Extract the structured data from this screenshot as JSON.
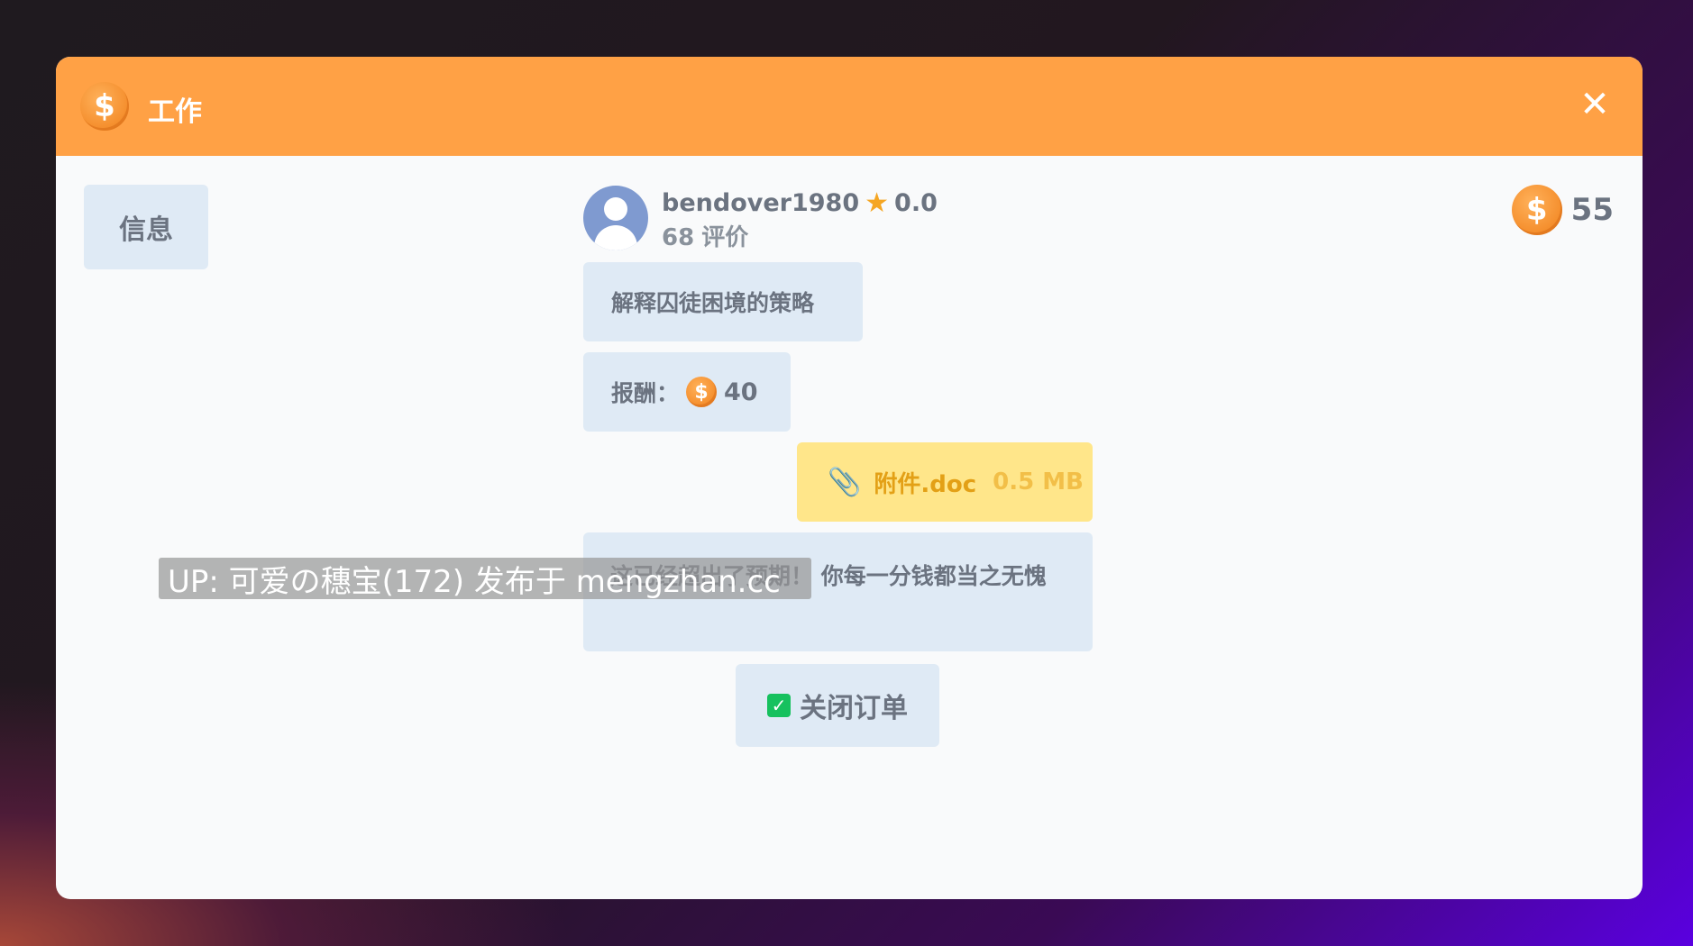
{
  "window": {
    "title": "工作",
    "close_label": "✕"
  },
  "sidebar": {
    "info_tab": "信息"
  },
  "balance": {
    "value": "55"
  },
  "user": {
    "name": "bendover1980",
    "rating": "0.0",
    "review_count": "68",
    "review_label": "评价"
  },
  "job": {
    "task": "解释囚徒困境的策略",
    "reward_label": "报酬：",
    "reward_value": "40",
    "attachment_name": "附件.doc",
    "attachment_size": "0.5 MB",
    "message": "这已经超出了预期！ 你每一分钱都当之无愧",
    "close_order_label": "关闭订单"
  },
  "watermark": {
    "text": "UP: 可爱の穗宝(172) 发布于 mengzhan.cc"
  },
  "colors": {
    "titlebar": "#ffa145",
    "bubble": "#dfeaf5",
    "attachment": "#ffe68a",
    "checkbox": "#16c15e"
  }
}
